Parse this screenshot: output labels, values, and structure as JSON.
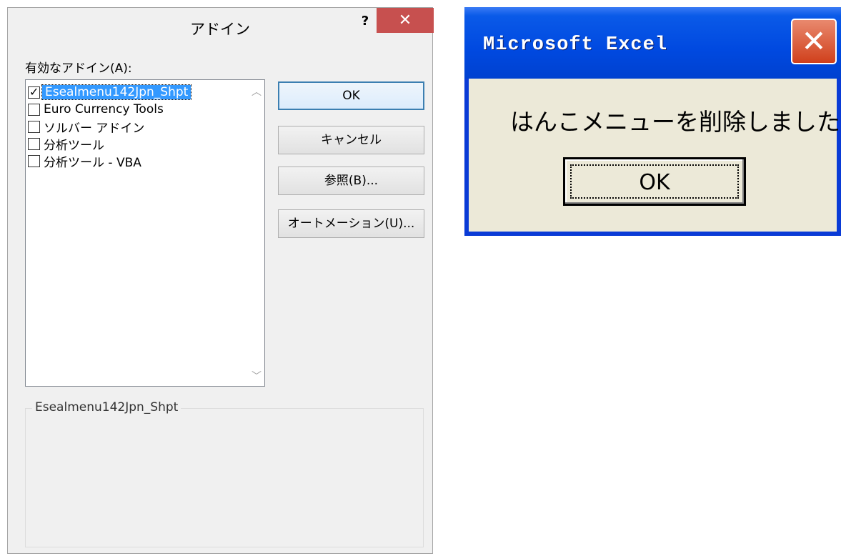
{
  "addins_dialog": {
    "title": "アドイン",
    "help_label": "?",
    "close_label": "✕",
    "list_label": "有効なアドイン(A):",
    "items": [
      {
        "label": "Esealmenu142Jpn_Shpt",
        "checked": true,
        "selected": true
      },
      {
        "label": "Euro Currency Tools",
        "checked": false,
        "selected": false
      },
      {
        "label": "ソルバー アドイン",
        "checked": false,
        "selected": false
      },
      {
        "label": "分析ツール",
        "checked": false,
        "selected": false
      },
      {
        "label": "分析ツール - VBA",
        "checked": false,
        "selected": false
      }
    ],
    "buttons": {
      "ok": "OK",
      "cancel": "キャンセル",
      "browse": "参照(B)...",
      "automation": "オートメーション(U)..."
    },
    "description_title": "Esealmenu142Jpn_Shpt"
  },
  "message_box": {
    "title": "Microsoft Excel",
    "close_label": "✕",
    "message": "はんこメニューを削除しました。",
    "ok_label": "OK"
  },
  "colors": {
    "close_red": "#c7504f",
    "xp_blue": "#0049e0",
    "xp_body": "#ece9d8",
    "selection_blue": "#3399ff"
  }
}
